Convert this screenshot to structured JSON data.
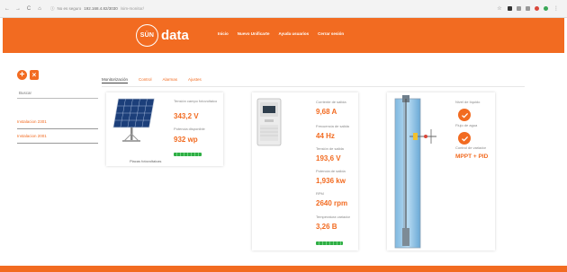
{
  "browser": {
    "back": "←",
    "forward": "→",
    "reload": "C",
    "home": "⌂",
    "secure_label": "No es seguro",
    "url_host": "192.168.4.82/3030",
    "url_path": "/sim-monitor/",
    "star": "☆"
  },
  "header": {
    "logo_circle": "SÜN",
    "logo_text": "data",
    "nav": [
      "Inicio",
      "Nuevo Unificarte",
      "Ayuda usuarios",
      "Cerrar sesión"
    ],
    "accent": "#f26b21"
  },
  "sidebar": {
    "add_icon": "+",
    "delete_icon": "×",
    "search_placeholder": "Buscar",
    "installations": [
      "Instalacion 2301",
      "Instalacion 2001"
    ]
  },
  "tabs": [
    "Monitorización",
    "Control",
    "Alarmas",
    "Ajustes"
  ],
  "solar": {
    "tension_label": "Tensión campo fotovoltaico",
    "tension_value": "343,2 V",
    "power_label": "Potencia disponible",
    "power_value": "932 wp",
    "caption": "Placas fotovoltaicas"
  },
  "drive": {
    "metrics": [
      {
        "label": "Corriente de salida",
        "value": "9,68 A"
      },
      {
        "label": "Frecuencia de salida",
        "value": "44 Hz"
      },
      {
        "label": "Tensión de salida",
        "value": "193,6 V"
      },
      {
        "label": "Potencia de salida",
        "value": "1,936 kw"
      },
      {
        "label": "RPM",
        "value": "2640 rpm"
      },
      {
        "label": "Temperatura variador",
        "value": "3,26 B"
      }
    ]
  },
  "pump": {
    "level_label": "Nivel de líquido",
    "flow_label": "Flujo de agua",
    "mode_label": "Control de variador",
    "mode_value": "MPPT + PID",
    "status_color": "#2fae45"
  }
}
